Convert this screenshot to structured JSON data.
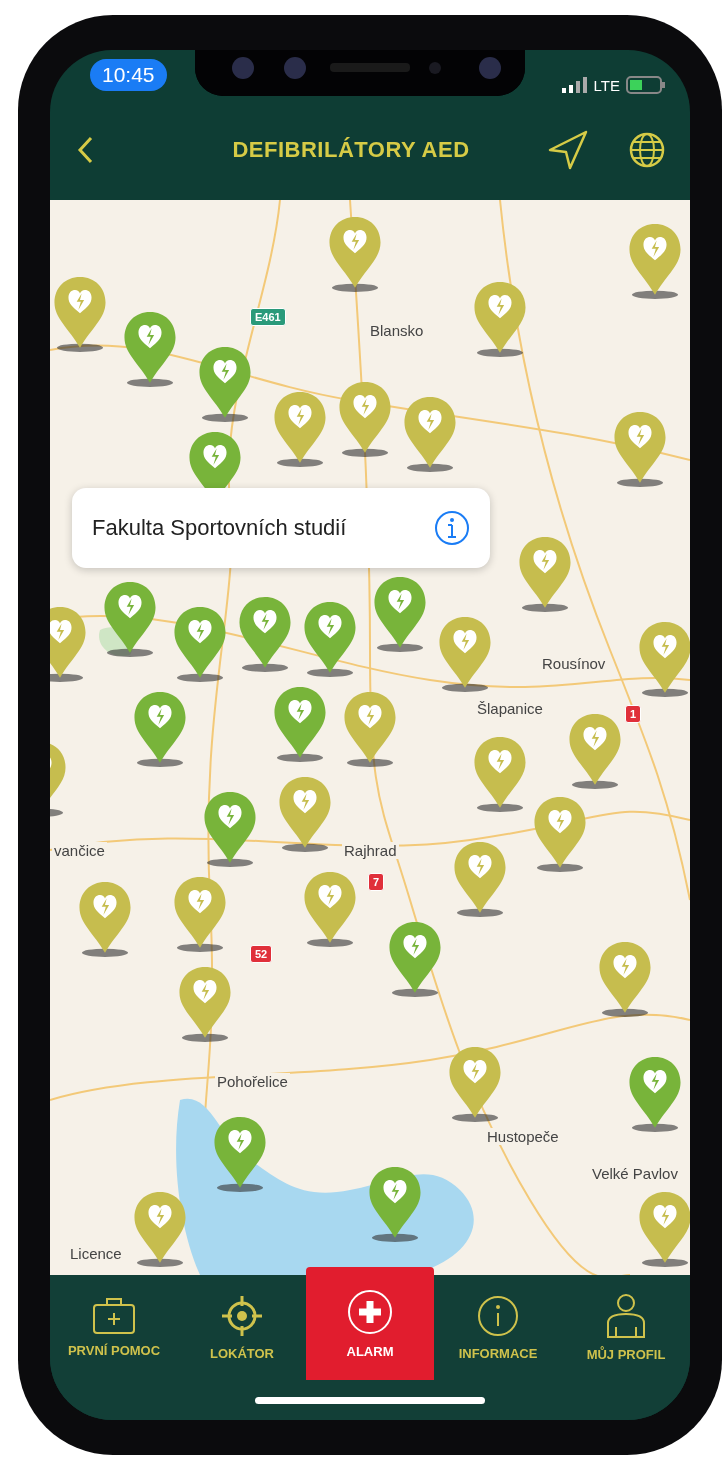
{
  "status_bar": {
    "time": "10:45",
    "network": "LTE"
  },
  "header": {
    "title": "DEFIBRILÁTORY AED"
  },
  "map": {
    "labels": [
      "Blansko",
      "Rousínov",
      "Šlapanice",
      "vančice",
      "Rajhrad",
      "Pohořelice",
      "Hustopeče",
      "Velké Pavlov",
      "Licence"
    ],
    "road_signs": [
      {
        "text": "E461",
        "color": "#2a9a7a"
      },
      {
        "text": "1",
        "color": "#e0303a"
      },
      {
        "text": "7",
        "color": "#e0303a"
      },
      {
        "text": "52",
        "color": "#e0303a"
      }
    ],
    "pins": [
      {
        "color": "#c6bd4e"
      },
      {
        "color": "#78b43a"
      },
      {
        "color": "#c6bd4e"
      },
      {
        "color": "#c6bd4e"
      },
      {
        "color": "#c6bd4e"
      },
      {
        "color": "#78b43a"
      },
      {
        "color": "#c6bd4e"
      },
      {
        "color": "#c6bd4e"
      },
      {
        "color": "#c6bd4e"
      },
      {
        "color": "#c6bd4e"
      },
      {
        "color": "#78b43a"
      },
      {
        "color": "#c6bd4e"
      },
      {
        "color": "#c6bd4e"
      },
      {
        "color": "#78b43a"
      },
      {
        "color": "#78b43a"
      },
      {
        "color": "#78b43a"
      },
      {
        "color": "#78b43a"
      },
      {
        "color": "#78b43a"
      },
      {
        "color": "#c6bd4e"
      },
      {
        "color": "#c6bd4e"
      },
      {
        "color": "#c6bd4e"
      },
      {
        "color": "#78b43a"
      },
      {
        "color": "#78b43a"
      },
      {
        "color": "#c6bd4e"
      },
      {
        "color": "#c6bd4e"
      },
      {
        "color": "#c6bd4e"
      },
      {
        "color": "#78b43a"
      },
      {
        "color": "#c6bd4e"
      },
      {
        "color": "#c6bd4e"
      },
      {
        "color": "#c6bd4e"
      },
      {
        "color": "#c6bd4e"
      },
      {
        "color": "#c6bd4e"
      },
      {
        "color": "#c6bd4e"
      },
      {
        "color": "#78b43a"
      },
      {
        "color": "#c6bd4e"
      },
      {
        "color": "#c6bd4e"
      },
      {
        "color": "#c6bd4e"
      },
      {
        "color": "#78b43a"
      },
      {
        "color": "#78b43a"
      },
      {
        "color": "#78b43a"
      },
      {
        "color": "#c6bd4e"
      },
      {
        "color": "#c6bd4e"
      }
    ],
    "callout": {
      "text": "Fakulta Sportovních studií"
    }
  },
  "tabs": [
    {
      "label": "PRVNÍ POMOC",
      "kind": "kit",
      "selected": false
    },
    {
      "label": "LOKÁTOR",
      "kind": "target",
      "selected": false
    },
    {
      "label": "ALARM",
      "kind": "alarm",
      "selected": true
    },
    {
      "label": "INFORMACE",
      "kind": "info",
      "selected": false
    },
    {
      "label": "MŮJ PROFIL",
      "kind": "profile",
      "selected": false
    }
  ]
}
